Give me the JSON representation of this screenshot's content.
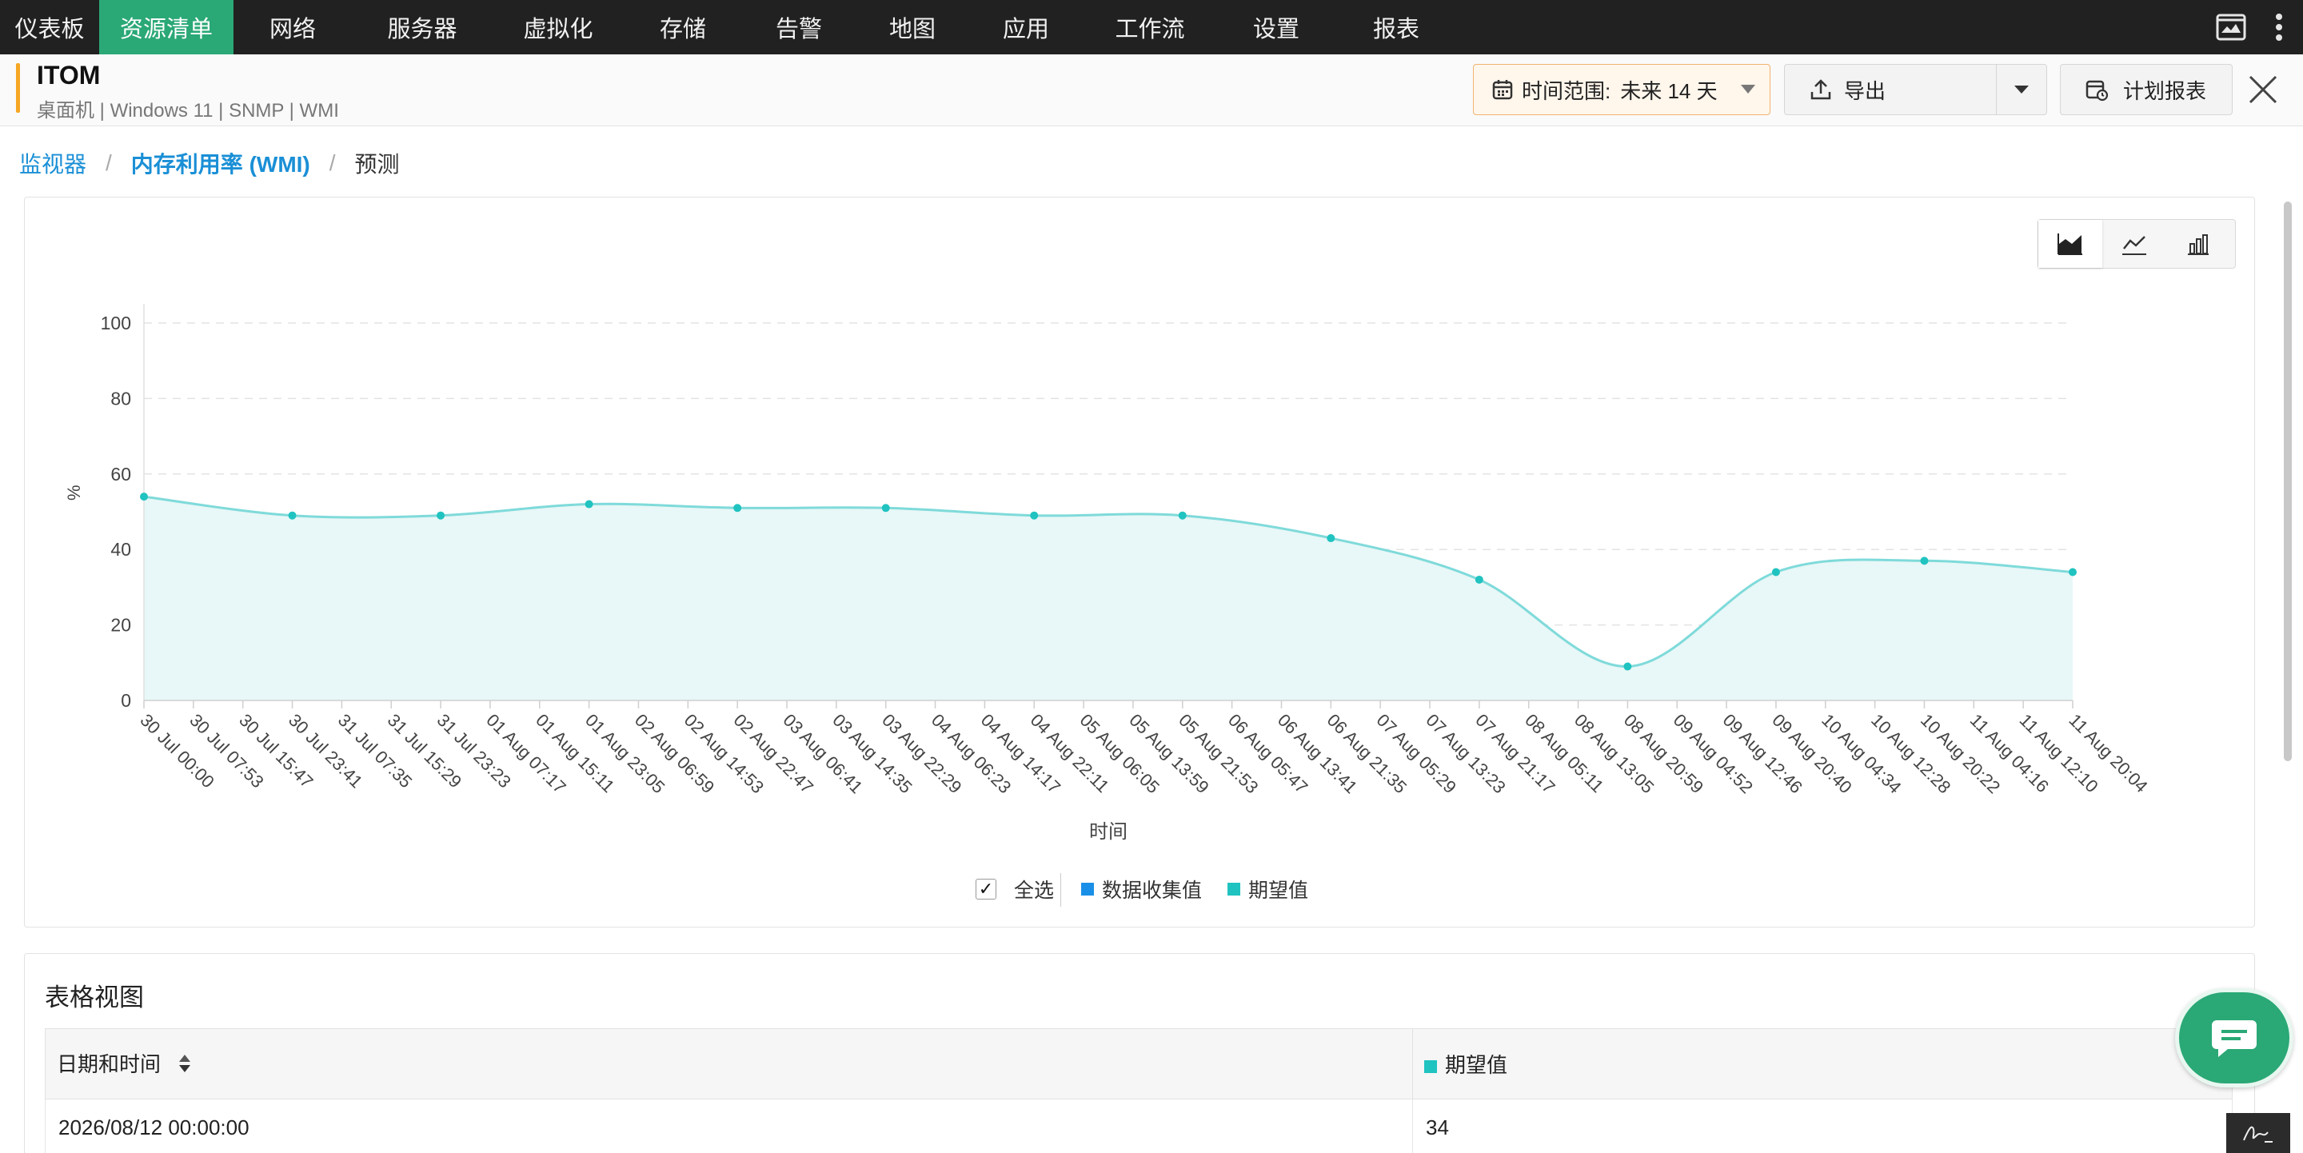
{
  "nav": {
    "items": [
      "仪表板",
      "资源清单",
      "网络",
      "服务器",
      "虚拟化",
      "存储",
      "告警",
      "地图",
      "应用",
      "工作流",
      "设置",
      "报表"
    ],
    "active_index": 1,
    "right_icons": [
      "console-icon",
      "more-vertical-icon"
    ]
  },
  "header": {
    "title": "ITOM",
    "meta": "桌面机 | Windows 11 | SNMP | WMI",
    "time_range_label": "时间范围:",
    "time_range_value": "未来 14 天",
    "export_label": "导出",
    "schedule_label": "计划报表"
  },
  "breadcrumb": {
    "items": [
      "监视器",
      "内存利用率 (WMI)"
    ],
    "current": "预测"
  },
  "chart_data": {
    "type": "area",
    "ylabel": "%",
    "xlabel": "时间",
    "ylim": [
      0,
      100
    ],
    "yticks": [
      0,
      20,
      40,
      60,
      80,
      100
    ],
    "grid": true,
    "x_ticks": [
      "30 Jul 00:00",
      "30 Jul 07:53",
      "30 Jul 15:47",
      "30 Jul 23:41",
      "31 Jul 07:35",
      "31 Jul 15:29",
      "31 Jul 23:23",
      "01 Aug 07:17",
      "01 Aug 15:11",
      "01 Aug 23:05",
      "02 Aug 06:59",
      "02 Aug 14:53",
      "02 Aug 22:47",
      "03 Aug 06:41",
      "03 Aug 14:35",
      "03 Aug 22:29",
      "04 Aug 06:23",
      "04 Aug 14:17",
      "04 Aug 22:11",
      "05 Aug 06:05",
      "05 Aug 13:59",
      "05 Aug 21:53",
      "06 Aug 05:47",
      "06 Aug 13:41",
      "06 Aug 21:35",
      "07 Aug 05:29",
      "07 Aug 13:23",
      "07 Aug 21:17",
      "08 Aug 05:11",
      "08 Aug 13:05",
      "08 Aug 20:59",
      "09 Aug 04:52",
      "09 Aug 12:46",
      "09 Aug 20:40",
      "10 Aug 04:34",
      "10 Aug 12:28",
      "10 Aug 20:22",
      "11 Aug 04:16",
      "11 Aug 12:10",
      "11 Aug 20:04"
    ],
    "point_tick_indices": [
      0,
      3,
      6,
      9,
      12,
      15,
      18,
      21,
      24,
      27,
      30,
      33,
      36,
      39
    ],
    "series": [
      {
        "name": "期望值",
        "color": "#20c3c0",
        "values": [
          54,
          49,
          49,
          52,
          51,
          51,
          49,
          49,
          43,
          32,
          9,
          34,
          37,
          34
        ]
      }
    ],
    "legend": {
      "select_all": "全选",
      "items": [
        {
          "label": "数据收集值",
          "color": "#1a8fe8"
        },
        {
          "label": "期望值",
          "color": "#20c3c0"
        }
      ]
    }
  },
  "view_toggle": [
    "area-chart-icon",
    "line-chart-icon",
    "bar-chart-icon"
  ],
  "table": {
    "title": "表格视图",
    "col_datetime": "日期和时间",
    "col_value": "期望值",
    "rows": [
      {
        "datetime": "2026/08/12 00:00:00",
        "value": "34"
      }
    ]
  }
}
